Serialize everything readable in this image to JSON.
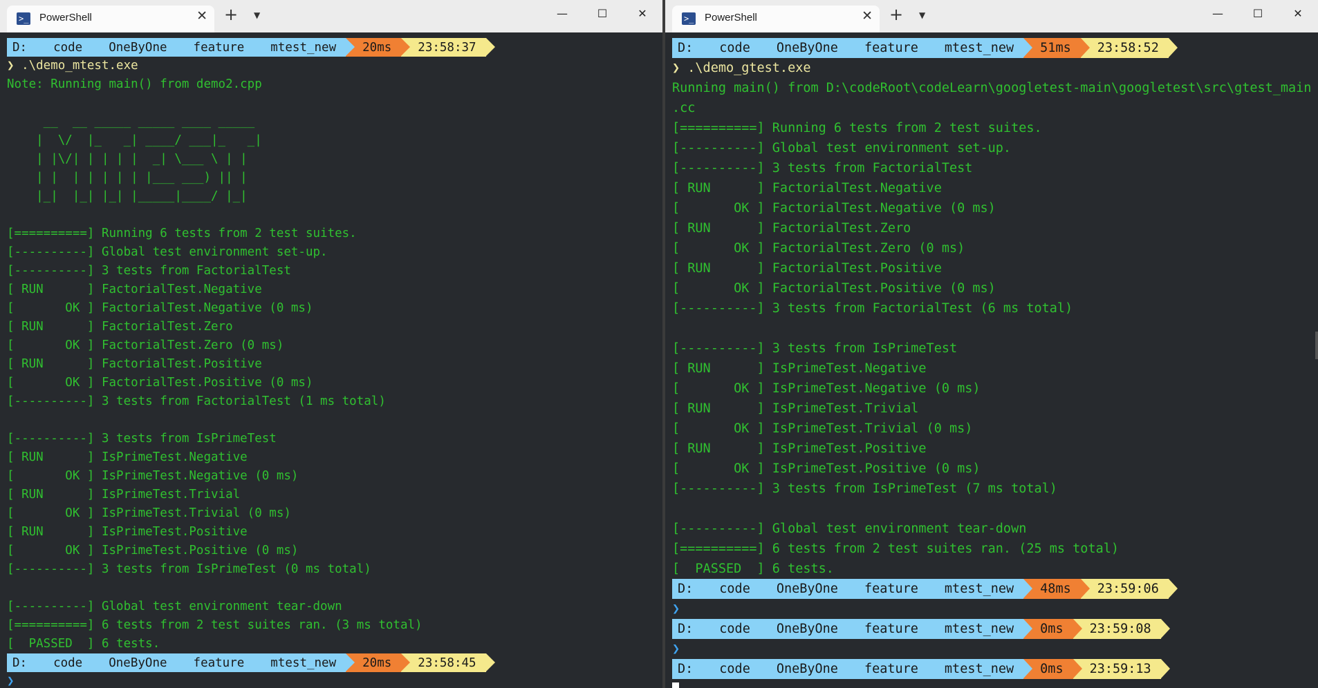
{
  "colors": {
    "terminal_bg": "#272a2e",
    "text_green": "#30c030",
    "path_blue": "#89d2f7",
    "duration_orange": "#f08033",
    "time_yellow": "#f5e98c",
    "caret_blue": "#3fa3f0"
  },
  "window_controls": {
    "minimize": "—",
    "maximize": "☐",
    "close": "✕"
  },
  "left": {
    "tab_title": "PowerShell",
    "prompt1": {
      "segments": [
        "D:",
        "code",
        "OneByOne",
        "feature",
        "mtest_new"
      ],
      "duration": "20ms",
      "time": "23:58:37"
    },
    "command": "❯ .\\demo_mtest.exe",
    "output": [
      "Note: Running main() from demo2.cpp",
      "",
      "     __  __ _____ _____ ____ _____",
      "    |  \\/  |_   _| ____/ ___|_   _|",
      "    | |\\/| | | | |  _| \\___ \\ | |",
      "    | |  | | | | | |___ ___) || |",
      "    |_|  |_| |_| |_____|____/ |_|",
      "",
      "[==========] Running 6 tests from 2 test suites.",
      "[----------] Global test environment set-up.",
      "[----------] 3 tests from FactorialTest",
      "[ RUN      ] FactorialTest.Negative",
      "[       OK ] FactorialTest.Negative (0 ms)",
      "[ RUN      ] FactorialTest.Zero",
      "[       OK ] FactorialTest.Zero (0 ms)",
      "[ RUN      ] FactorialTest.Positive",
      "[       OK ] FactorialTest.Positive (0 ms)",
      "[----------] 3 tests from FactorialTest (1 ms total)",
      "",
      "[----------] 3 tests from IsPrimeTest",
      "[ RUN      ] IsPrimeTest.Negative",
      "[       OK ] IsPrimeTest.Negative (0 ms)",
      "[ RUN      ] IsPrimeTest.Trivial",
      "[       OK ] IsPrimeTest.Trivial (0 ms)",
      "[ RUN      ] IsPrimeTest.Positive",
      "[       OK ] IsPrimeTest.Positive (0 ms)",
      "[----------] 3 tests from IsPrimeTest (0 ms total)",
      "",
      "[----------] Global test environment tear-down",
      "[==========] 6 tests from 2 test suites ran. (3 ms total)",
      "[  PASSED  ] 6 tests."
    ],
    "prompt2": {
      "segments": [
        "D:",
        "code",
        "OneByOne",
        "feature",
        "mtest_new"
      ],
      "duration": "20ms",
      "time": "23:58:45"
    },
    "caret": "❯"
  },
  "right": {
    "tab_title": "PowerShell",
    "prompt1": {
      "segments": [
        "D:",
        "code",
        "OneByOne",
        "feature",
        "mtest_new"
      ],
      "duration": "51ms",
      "time": "23:58:52"
    },
    "command": "❯ .\\demo_gtest.exe",
    "output": [
      "Running main() from D:\\codeRoot\\codeLearn\\googletest-main\\googletest\\src\\gtest_main",
      ".cc",
      "[==========] Running 6 tests from 2 test suites.",
      "[----------] Global test environment set-up.",
      "[----------] 3 tests from FactorialTest",
      "[ RUN      ] FactorialTest.Negative",
      "[       OK ] FactorialTest.Negative (0 ms)",
      "[ RUN      ] FactorialTest.Zero",
      "[       OK ] FactorialTest.Zero (0 ms)",
      "[ RUN      ] FactorialTest.Positive",
      "[       OK ] FactorialTest.Positive (0 ms)",
      "[----------] 3 tests from FactorialTest (6 ms total)",
      "",
      "[----------] 3 tests from IsPrimeTest",
      "[ RUN      ] IsPrimeTest.Negative",
      "[       OK ] IsPrimeTest.Negative (0 ms)",
      "[ RUN      ] IsPrimeTest.Trivial",
      "[       OK ] IsPrimeTest.Trivial (0 ms)",
      "[ RUN      ] IsPrimeTest.Positive",
      "[       OK ] IsPrimeTest.Positive (0 ms)",
      "[----------] 3 tests from IsPrimeTest (7 ms total)",
      "",
      "[----------] Global test environment tear-down",
      "[==========] 6 tests from 2 test suites ran. (25 ms total)",
      "[  PASSED  ] 6 tests."
    ],
    "prompt2": {
      "segments": [
        "D:",
        "code",
        "OneByOne",
        "feature",
        "mtest_new"
      ],
      "duration": "48ms",
      "time": "23:59:06"
    },
    "caret2": "❯",
    "prompt3": {
      "segments": [
        "D:",
        "code",
        "OneByOne",
        "feature",
        "mtest_new"
      ],
      "duration": "0ms",
      "time": "23:59:08"
    },
    "caret3": "❯",
    "prompt4": {
      "segments": [
        "D:",
        "code",
        "OneByOne",
        "feature",
        "mtest_new"
      ],
      "duration": "0ms",
      "time": "23:59:13"
    }
  }
}
